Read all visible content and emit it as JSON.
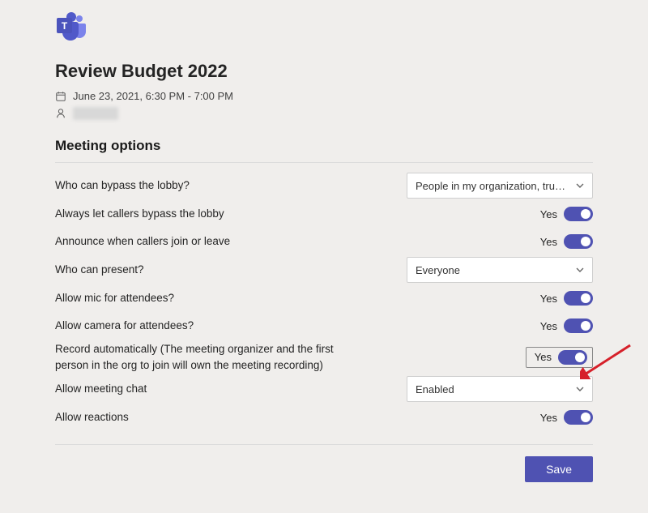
{
  "meeting": {
    "title": "Review Budget 2022",
    "datetime": "June 23, 2021, 6:30 PM - 7:00 PM"
  },
  "section_title": "Meeting options",
  "options": {
    "bypass_lobby": {
      "label": "Who can bypass the lobby?",
      "value": "People in my organization, truste…"
    },
    "callers_bypass": {
      "label": "Always let callers bypass the lobby",
      "value": "Yes"
    },
    "announce": {
      "label": "Announce when callers join or leave",
      "value": "Yes"
    },
    "present": {
      "label": "Who can present?",
      "value": "Everyone"
    },
    "allow_mic": {
      "label": "Allow mic for attendees?",
      "value": "Yes"
    },
    "allow_camera": {
      "label": "Allow camera for attendees?",
      "value": "Yes"
    },
    "record_auto": {
      "label": "Record automatically (The meeting organizer and the first person in the org to join will own the meeting recording)",
      "value": "Yes"
    },
    "allow_chat": {
      "label": "Allow meeting chat",
      "value": "Enabled"
    },
    "allow_reactions": {
      "label": "Allow reactions",
      "value": "Yes"
    }
  },
  "footer": {
    "save": "Save"
  }
}
